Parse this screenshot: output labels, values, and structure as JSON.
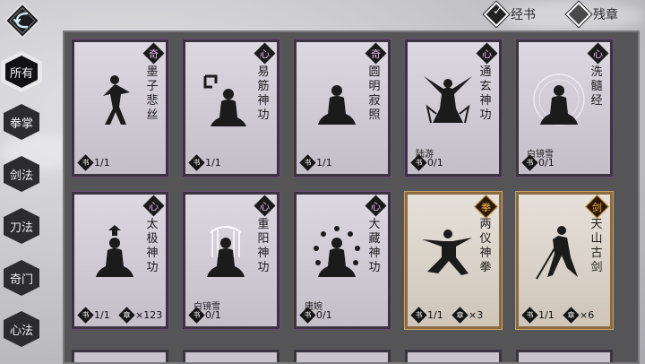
{
  "filters": {
    "jingshu": "经书",
    "canzhang": "残章"
  },
  "sidebar": [
    "所有",
    "拳掌",
    "剑法",
    "刀法",
    "奇门",
    "心法"
  ],
  "cards": [
    {
      "badge": "奇",
      "name": "墨子悲丝",
      "owner": "",
      "books": "1/1",
      "chapters": "",
      "tier": "purple"
    },
    {
      "badge": "心",
      "name": "易筋神功",
      "owner": "",
      "books": "1/1",
      "chapters": "",
      "tier": "purple"
    },
    {
      "badge": "奇",
      "name": "圆明寂照",
      "owner": "",
      "books": "1/1",
      "chapters": "",
      "tier": "purple"
    },
    {
      "badge": "心",
      "name": "通玄神功",
      "owner": "陆游",
      "books": "0/1",
      "chapters": "",
      "tier": "purple"
    },
    {
      "badge": "心",
      "name": "洗髓经",
      "owner": "白镜雪",
      "books": "0/1",
      "chapters": "",
      "tier": "purple"
    },
    {
      "badge": "心",
      "name": "太极神功",
      "owner": "",
      "books": "1/1",
      "chapters": "×123",
      "tier": "purple"
    },
    {
      "badge": "心",
      "name": "重阳神功",
      "owner": "白镜雪",
      "books": "0/1",
      "chapters": "",
      "tier": "purple"
    },
    {
      "badge": "心",
      "name": "大藏神功",
      "owner": "唐婉",
      "books": "0/1",
      "chapters": "",
      "tier": "purple"
    },
    {
      "badge": "拳",
      "name": "两仪神拳",
      "owner": "",
      "books": "1/1",
      "chapters": "×3",
      "tier": "gold"
    },
    {
      "badge": "剑",
      "name": "天山古剑",
      "owner": "",
      "books": "1/1",
      "chapters": "×6",
      "tier": "gold"
    }
  ],
  "icons": {
    "book": "书",
    "chapter": "章"
  }
}
